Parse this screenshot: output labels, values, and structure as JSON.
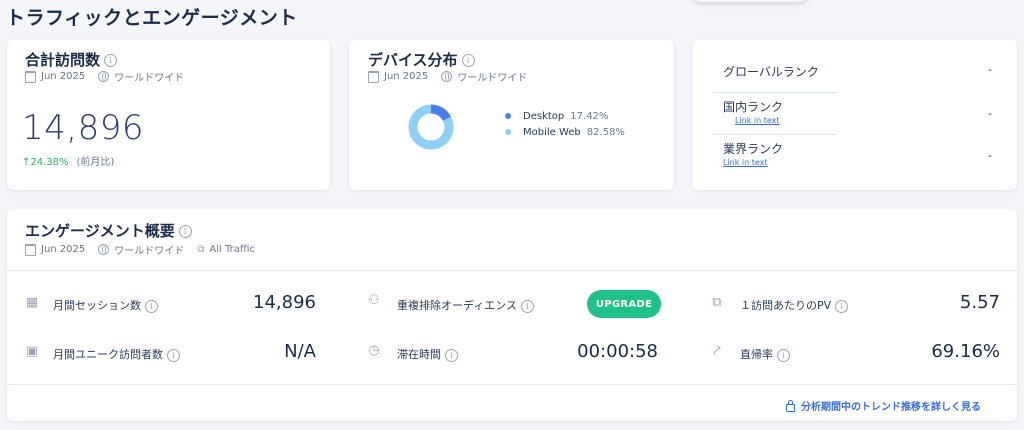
{
  "page": {
    "title": "トラフィックとエンゲージメント"
  },
  "visits": {
    "title": "合計訪問数",
    "period": "Jun 2025",
    "region": "ワールドワイド",
    "value": "14,896",
    "change": "↑24.38%",
    "change_note": "(前月比)",
    "colors": {
      "positive": "#2fb35d"
    }
  },
  "devices": {
    "title": "デバイス分布",
    "period": "Jun 2025",
    "region": "ワールドワイド",
    "items": [
      {
        "label": "Desktop",
        "percent": "17.42%",
        "value": 17.42,
        "color": "#4a7df0"
      },
      {
        "label": "Mobile Web",
        "percent": "82.58%",
        "value": 82.58,
        "color": "#8fd0f7"
      }
    ]
  },
  "ranks": {
    "items": [
      {
        "label": "グローバルランク",
        "value": "-",
        "link": ""
      },
      {
        "label": "国内ランク",
        "value": "-",
        "link": "Link in text"
      },
      {
        "label": "業界ランク",
        "value": "-",
        "link": "Link in text"
      }
    ]
  },
  "engagement": {
    "title": "エンゲージメント概要",
    "period": "Jun 2025",
    "region": "ワールドワイド",
    "traffic": "All Traffic",
    "metrics": {
      "monthly_sessions": {
        "label": "月間セッション数",
        "value": "14,896",
        "icon": "calendar-icon"
      },
      "dedup_audience": {
        "label": "重複排除オーディエンス",
        "button": "UPGRADE",
        "icon": "users-icon"
      },
      "pv_per_visit": {
        "label": "１訪問あたりのPV",
        "value": "5.57",
        "icon": "pages-icon"
      },
      "monthly_unique": {
        "label": "月間ユニーク訪問者数",
        "value": "N/A",
        "icon": "person-badge-icon"
      },
      "duration": {
        "label": "滞在時間",
        "value": "00:00:58",
        "icon": "stopwatch-icon"
      },
      "bounce_rate": {
        "label": "直帰率",
        "value": "69.16%",
        "icon": "trend-icon"
      }
    },
    "trend_link": "分析期間中のトレンド推移を詳しく見る"
  },
  "colors": {
    "accent": "#3a6fd8",
    "upgrade": "#1fc08a"
  }
}
